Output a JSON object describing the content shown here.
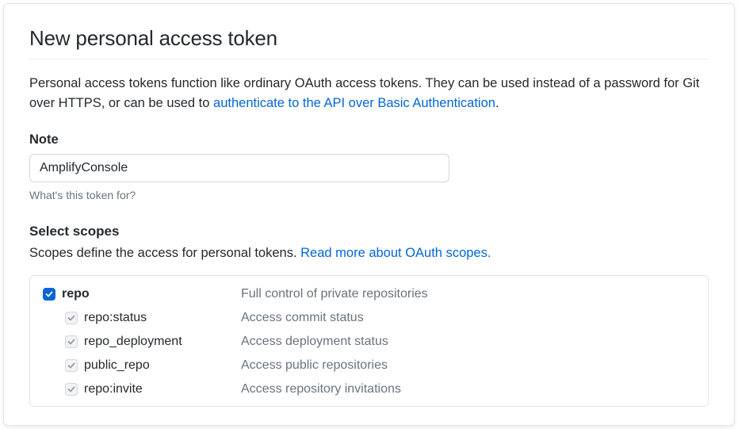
{
  "header": {
    "title": "New personal access token"
  },
  "intro": {
    "text_before": "Personal access tokens function like ordinary OAuth access tokens. They can be used instead of a password for Git over HTTPS, or can be used to ",
    "link_text": "authenticate to the API over Basic Authentication",
    "text_after": "."
  },
  "note": {
    "label": "Note",
    "value": "AmplifyConsole",
    "help": "What's this token for?"
  },
  "scopes": {
    "title": "Select scopes",
    "desc_before": "Scopes define the access for personal tokens. ",
    "link_text": "Read more about OAuth scopes.",
    "groups": [
      {
        "name": "repo",
        "desc": "Full control of private repositories",
        "checked": true,
        "children": [
          {
            "name": "repo:status",
            "desc": "Access commit status"
          },
          {
            "name": "repo_deployment",
            "desc": "Access deployment status"
          },
          {
            "name": "public_repo",
            "desc": "Access public repositories"
          },
          {
            "name": "repo:invite",
            "desc": "Access repository invitations"
          }
        ]
      }
    ]
  }
}
